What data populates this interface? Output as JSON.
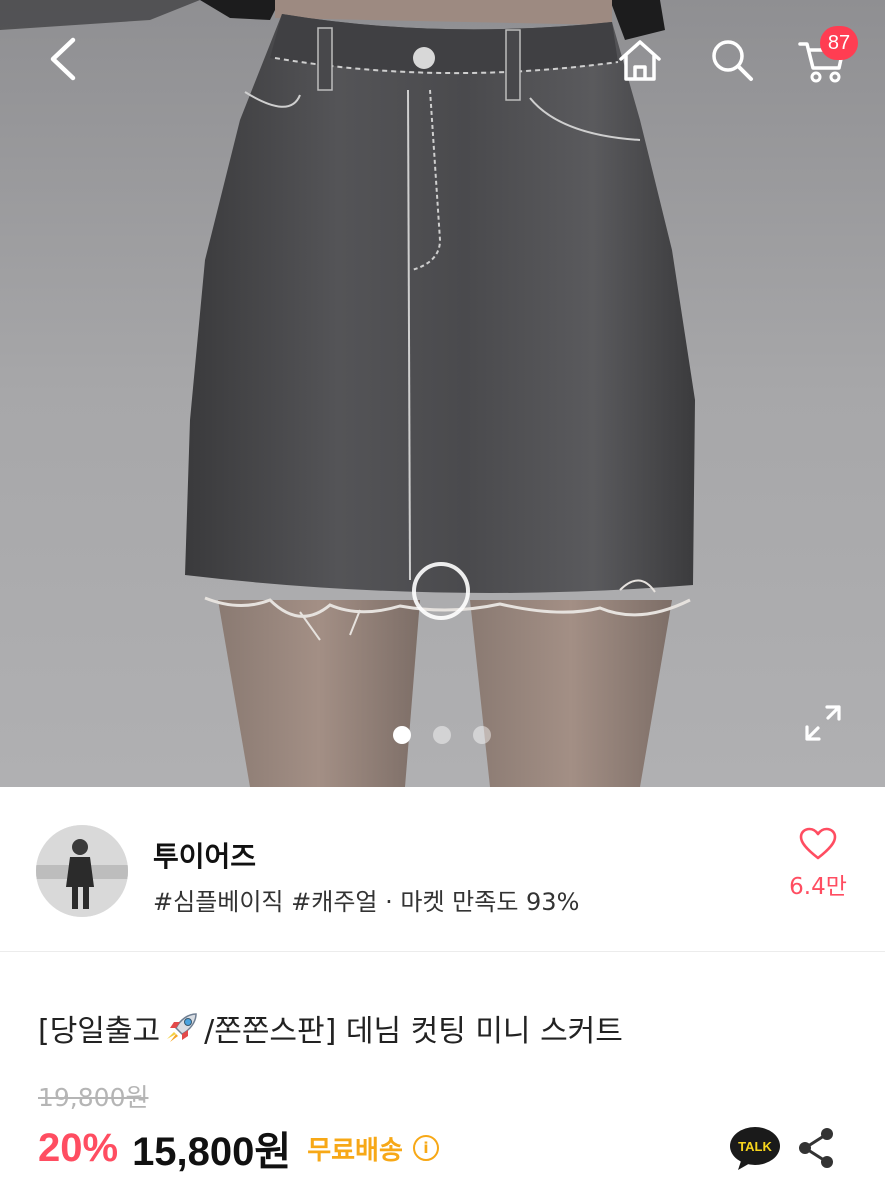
{
  "header": {
    "cart_count": "87",
    "icons": [
      "chevron-left-icon",
      "home-icon",
      "search-icon",
      "cart-icon"
    ]
  },
  "gallery": {
    "slide_count": 3,
    "active_index": 0,
    "icons": [
      "zoom-ring-icon",
      "expand-icon"
    ]
  },
  "seller": {
    "name": "투이어즈",
    "tags": "#심플베이직 #캐주얼 · 마켓 만족도 93%",
    "like_count": "6.4만"
  },
  "product": {
    "title_prefix": "[당일출고",
    "title_suffix": "/쫀쫀스판] 데님 컷팅 미니 스커트",
    "original_price": "19,800원",
    "discount": "20%",
    "price": "15,800원",
    "shipping": "무료배송"
  },
  "actions": {
    "talk_label": "TALK"
  },
  "colors": {
    "accent": "#ff4d61",
    "badge": "#ff3d52",
    "shipping": "#f7a816"
  }
}
